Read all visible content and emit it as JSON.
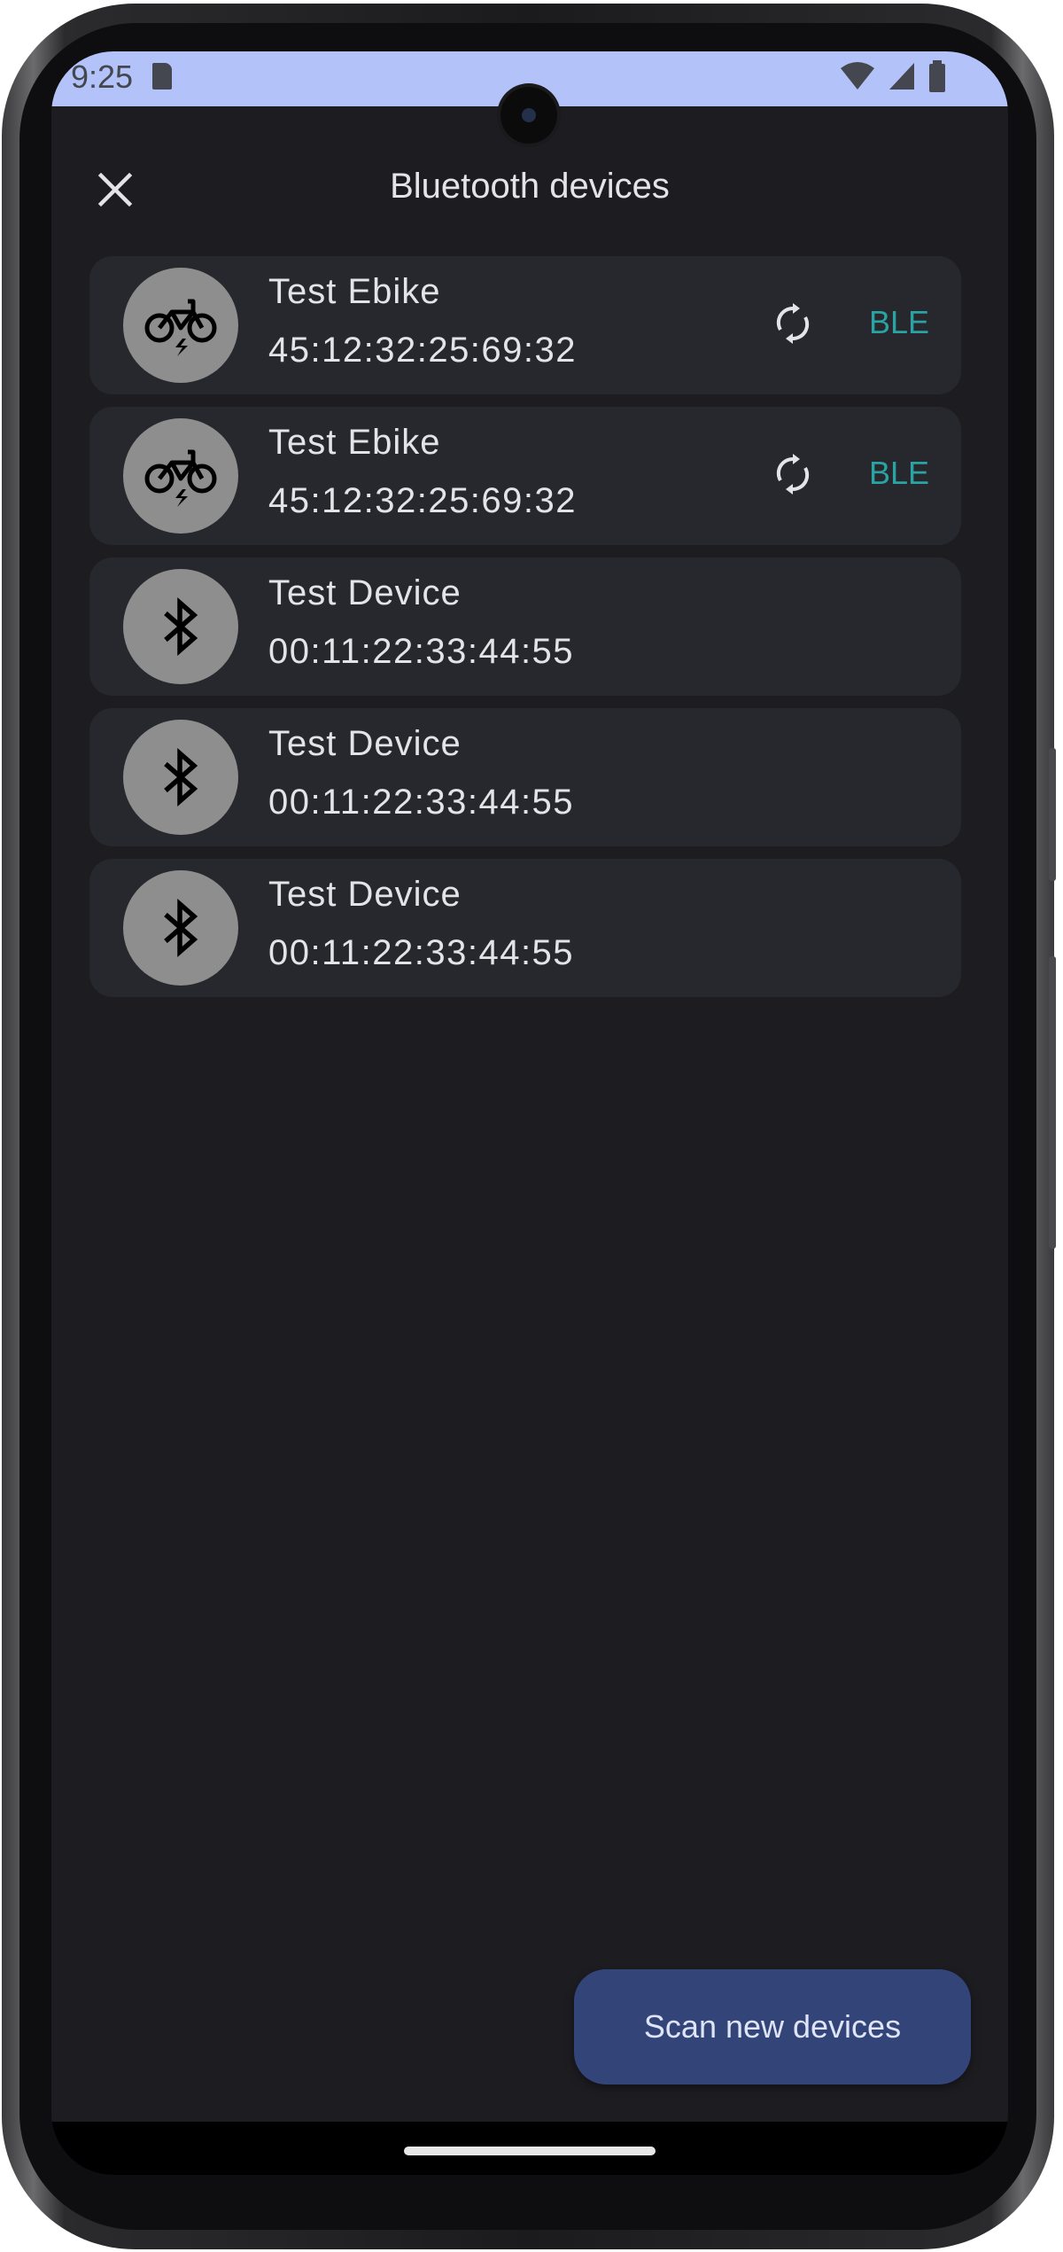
{
  "status_bar": {
    "time": "9:25",
    "icons": [
      "sd-card-icon",
      "wifi-icon",
      "cellular-signal-icon",
      "battery-icon"
    ]
  },
  "app_bar": {
    "title": "Bluetooth devices",
    "close_icon": "close-icon"
  },
  "devices": [
    {
      "name": "Test Ebike",
      "address": "45:12:32:25:69:32",
      "icon": "ebike-icon",
      "has_sync": true,
      "tag": "BLE"
    },
    {
      "name": "Test Ebike",
      "address": "45:12:32:25:69:32",
      "icon": "ebike-icon",
      "has_sync": true,
      "tag": "BLE"
    },
    {
      "name": "Test Device",
      "address": "00:11:22:33:44:55",
      "icon": "bluetooth-icon",
      "has_sync": false,
      "tag": ""
    },
    {
      "name": "Test Device",
      "address": "00:11:22:33:44:55",
      "icon": "bluetooth-icon",
      "has_sync": false,
      "tag": ""
    },
    {
      "name": "Test Device",
      "address": "00:11:22:33:44:55",
      "icon": "bluetooth-icon",
      "has_sync": false,
      "tag": ""
    }
  ],
  "fab": {
    "label": "Scan new devices"
  },
  "colors": {
    "status_bar_bg": "#b3c3f9",
    "screen_bg": "#1c1c21",
    "card_bg": "#27282d",
    "avatar_bg": "#8e8e8e",
    "ble_accent": "#2aa3a3",
    "fab_bg": "#334479"
  }
}
